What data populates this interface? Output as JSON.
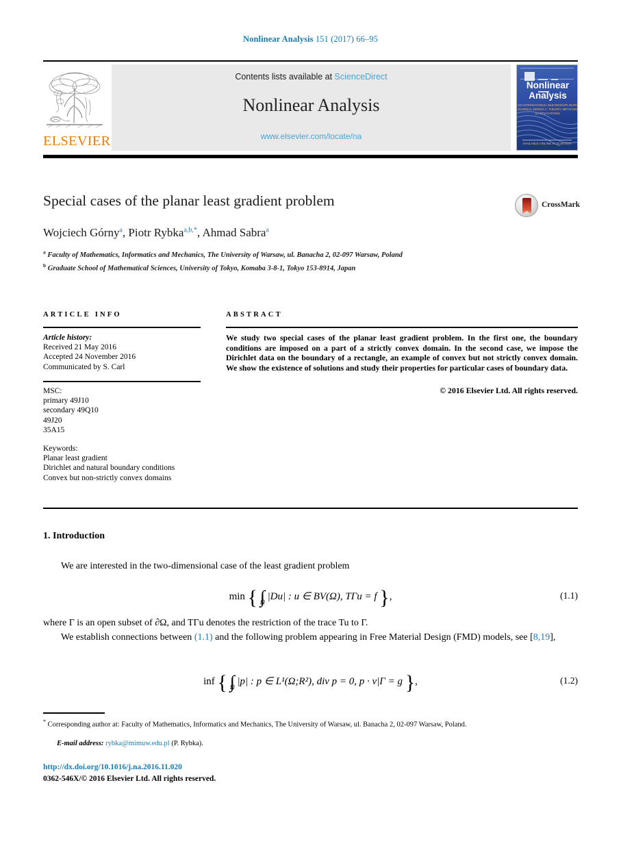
{
  "running_head": {
    "journal": "Nonlinear Analysis",
    "citation": " 151 (2017) 66–95"
  },
  "header": {
    "publisher_logo_text": "ELSEVIER",
    "contents_prefix": "Contents lists available at ",
    "contents_link": "ScienceDirect",
    "journal_title": "Nonlinear Analysis",
    "journal_url": "www.elsevier.com/locate/na",
    "cover": {
      "title_line1": "Nonlinear",
      "title_line2": "Analysis",
      "subtitle": "AN INTERNATIONAL MULTIDISCIPLINARY JOURNAL SERIES A: THEORY, METHODS & APPLICATIONS",
      "footer": "AVAILABLE ONLINE AT ELSEVIER"
    }
  },
  "article": {
    "title": "Special cases of the planar least gradient problem",
    "crossmark_label": "CrossMark",
    "authors": [
      {
        "name": "Wojciech Górny",
        "marks": "a"
      },
      {
        "name": "Piotr Rybka",
        "marks": "a,b,*"
      },
      {
        "name": "Ahmad Sabra",
        "marks": "a"
      }
    ],
    "affiliations": [
      {
        "mark": "a",
        "text": "Faculty of Mathematics, Informatics and Mechanics, The University of Warsaw, ul. Banacha 2, 02-097 Warsaw, Poland"
      },
      {
        "mark": "b",
        "text": "Graduate School of Mathematical Sciences, University of Tokyo, Komaba 3-8-1, Tokyo 153-8914, Japan"
      }
    ]
  },
  "info": {
    "heading": "ARTICLE INFO",
    "history_label": "Article history:",
    "history": [
      "Received 21 May 2016",
      "Accepted 24 November 2016",
      "Communicated by S. Carl"
    ],
    "msc_label": "MSC:",
    "msc": [
      "primary 49J10",
      "secondary 49Q10",
      "49J20",
      "35A15"
    ],
    "keywords_label": "Keywords:",
    "keywords": [
      "Planar least gradient",
      "Dirichlet and natural boundary conditions",
      "Convex but non-strictly convex domains"
    ]
  },
  "abstract": {
    "heading": "ABSTRACT",
    "text": "We study two special cases of the planar least gradient problem. In the first one, the boundary conditions are imposed on a part of a strictly convex domain. In the second case, we impose the Dirichlet data on the boundary of a rectangle, an example of convex but not strictly convex domain. We show the existence of solutions and study their properties for particular cases of boundary data.",
    "copyright": "© 2016 Elsevier Ltd. All rights reserved."
  },
  "body": {
    "section_title": "1. Introduction",
    "p1": "We are interested in the two-dimensional case of the least gradient problem",
    "eq1": {
      "lhs": "min",
      "body": "|Du| : u ∈ BV(Ω), TΓu = f",
      "integral_sub": "Ω",
      "number": "(1.1)"
    },
    "p2": "where Γ is an open subset of ∂Ω, and TΓu denotes the restriction of the trace Tu to Γ.",
    "p3_a": "We establish connections between ",
    "p3_ref1": "(1.1)",
    "p3_b": " and the following problem appearing in Free Material Design (FMD) models, see [",
    "p3_ref2": "8,19",
    "p3_c": "],",
    "eq2": {
      "lhs": "inf",
      "body": "|p| : p ∈ L¹(Ω;R²), div p = 0, p · ν|Γ = g",
      "integral_sub": "Ω",
      "number": "(1.2)"
    }
  },
  "footnotes": {
    "corresponding": "Corresponding author at: Faculty of Mathematics, Informatics and Mechanics, The University of Warsaw, ul. Banacha 2, 02-097 Warsaw, Poland.",
    "email_label": "E-mail address:",
    "email": "rybka@mimuw.edu.pl",
    "email_owner": "(P. Rybka).",
    "doi": "http://dx.doi.org/10.1016/j.na.2016.11.020",
    "issn_line": "0362-546X/© 2016 Elsevier Ltd. All rights reserved."
  },
  "colors": {
    "link": "#1a7bb0",
    "link_light": "#4ba3d3",
    "elsevier_orange": "#f07d00",
    "cover_blue": "#2f4fa6",
    "crossmark_red": "#c0392b"
  }
}
